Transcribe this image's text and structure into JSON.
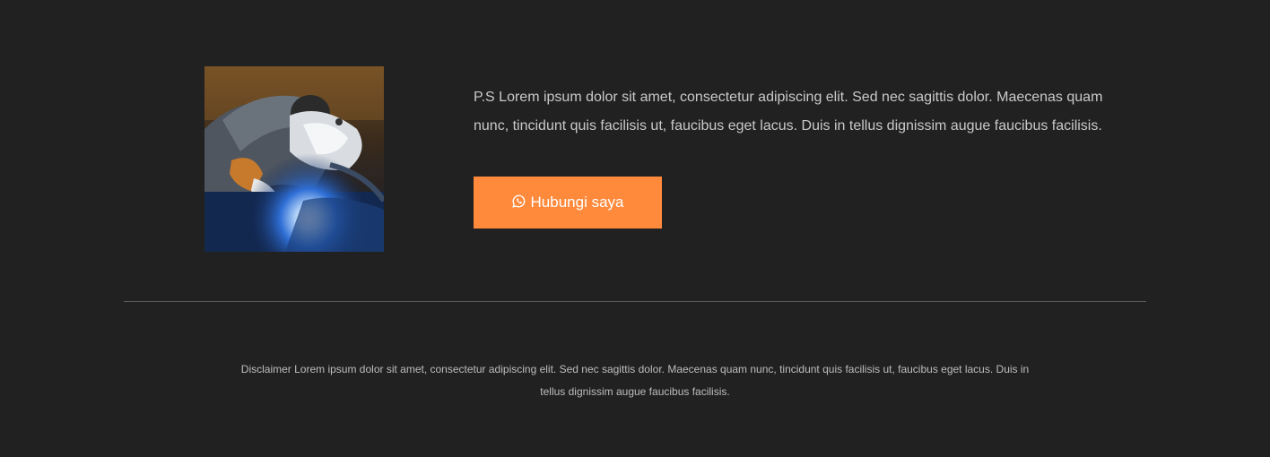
{
  "cta_section": {
    "image_alt": "welder-photo",
    "ps_text": "P.S Lorem ipsum dolor sit amet, consectetur adipiscing elit. Sed nec sagittis dolor. Maecenas quam nunc, tincidunt quis facilisis ut, faucibus eget lacus. Duis in tellus dignissim augue faucibus facilisis.",
    "button_label": "Hubungi saya",
    "button_icon": "whatsapp-icon",
    "button_color": "#ff8a3c"
  },
  "footer": {
    "disclaimer": "Disclaimer Lorem ipsum dolor sit amet, consectetur adipiscing elit. Sed nec sagittis dolor. Maecenas quam nunc, tincidunt quis facilisis ut, faucibus eget lacus. Duis in tellus dignissim augue faucibus facilisis."
  },
  "colors": {
    "background": "#212121",
    "text": "#c9c9c9",
    "divider": "#5a5a5a"
  }
}
